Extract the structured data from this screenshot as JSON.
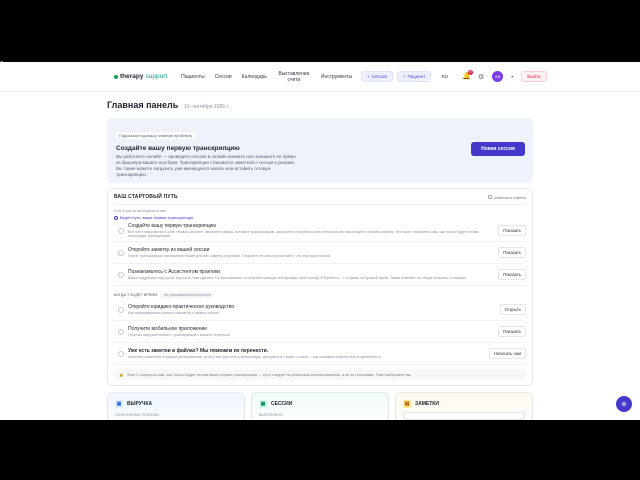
{
  "header": {
    "logo_bold": "therapy",
    "logo_light": "support",
    "nav": [
      "Пациенты",
      "Сессии",
      "Календарь",
      "Выставление счета",
      "Инструменты"
    ],
    "session_btn": "Сессия",
    "patient_btn": "Пациент",
    "lang": "RU",
    "notif_count": "6",
    "avatar": "AB",
    "logout": "Выйти"
  },
  "page": {
    "title": "Главная панель",
    "date": "16 сентября 2026 г."
  },
  "banner": {
    "tag": "Подсказка под вашу главную проблему",
    "title": "Создайте вашу первую транскрипцию",
    "text": "Вы работаете онлайн — проведите сессию в онлайн-комнате или запишите её прямо из браузера вашего ноутбука. Транскрипция становится заметкой о сессии и резюме. Вы также можете загрузить уже имеющуюся запись или вставить готовую транскрипцию.",
    "button": "Новая сессия"
  },
  "start": {
    "title": "ВАШ СТАРТОВЫЙ ПУТЬ",
    "change": "Изменить ответы",
    "progress": "0 из 3 шагов на первом этапе",
    "current": "Ведёт путь: ваша первая транскрипция",
    "items1": [
      {
        "title": "Создайте вашу первую транскрипцию",
        "desc": "Все пути начинаются в окне «Новая сессия»: запустите запись, вставьте транскрипцию, загрузите из ноутбука или телефона или используйте онлайн-комнату. Этот шаг становится сам, как только будет готова настоящая транскрипция.",
        "btn": "Показать"
      },
      {
        "title": "Откройте заметку из вашей сессии",
        "desc": "После транскрипции приложение пишет для вас заметку и резюме. Откройте сессию и прочитайте, что она подготовила.",
        "btn": "Показать"
      },
      {
        "title": "Познакомьтесь с Ассистентом практики",
        "desc": "Ваша поддержка под рукой: спросите «как сделать Х в приложении» и получите краткую инструкцию; либо кнопку «Перейти к…» и прямо на нужный экран. Также отвечает на общие вопросы о терапии.",
        "btn": "Показать"
      }
    ],
    "when_label": "КОГДА У БУДЕТ ВРЕМЯ",
    "when_tag": "не учитывается в прогрессе",
    "items2": [
      {
        "title": "Откройте юридико-практическое руководство",
        "desc": "Как информировать вашего пациента о записи сессии",
        "btn": "Открыть"
      },
      {
        "title": "Получите мобильное приложение",
        "desc": "Простая загрузка сессии и транскрипция с вашего телефона",
        "btn": "Показать"
      },
      {
        "title": "Уже есть заметки в файлах? Мы поможем их перенести.",
        "desc": "Короткое заявление в вашем распоряжении, если у вас уже есть транскрипции, для работы с ними: и сами — мы поможем собрать всё в одном месте.",
        "btn": "Написать нам"
      }
    ],
    "note": "Этап 2 откроется сам, как только будет готова ваша первая транскрипция — путь следует за реальным использованием, а не за галочками. Темп выбираете вы."
  },
  "cards": {
    "revenue_title": "ВЫРУЧКА",
    "revenue_sub": "ПОЛУЧЕННЫЕ ПЛАТЕЖИ",
    "sessions_title": "СЕССИИ",
    "sessions_sub": "ВЫПОЛНЕНО",
    "notes_title": "ЗАМЕТКИ"
  },
  "colors": {
    "accent": "#4338ca",
    "logout": "#e11d48"
  }
}
